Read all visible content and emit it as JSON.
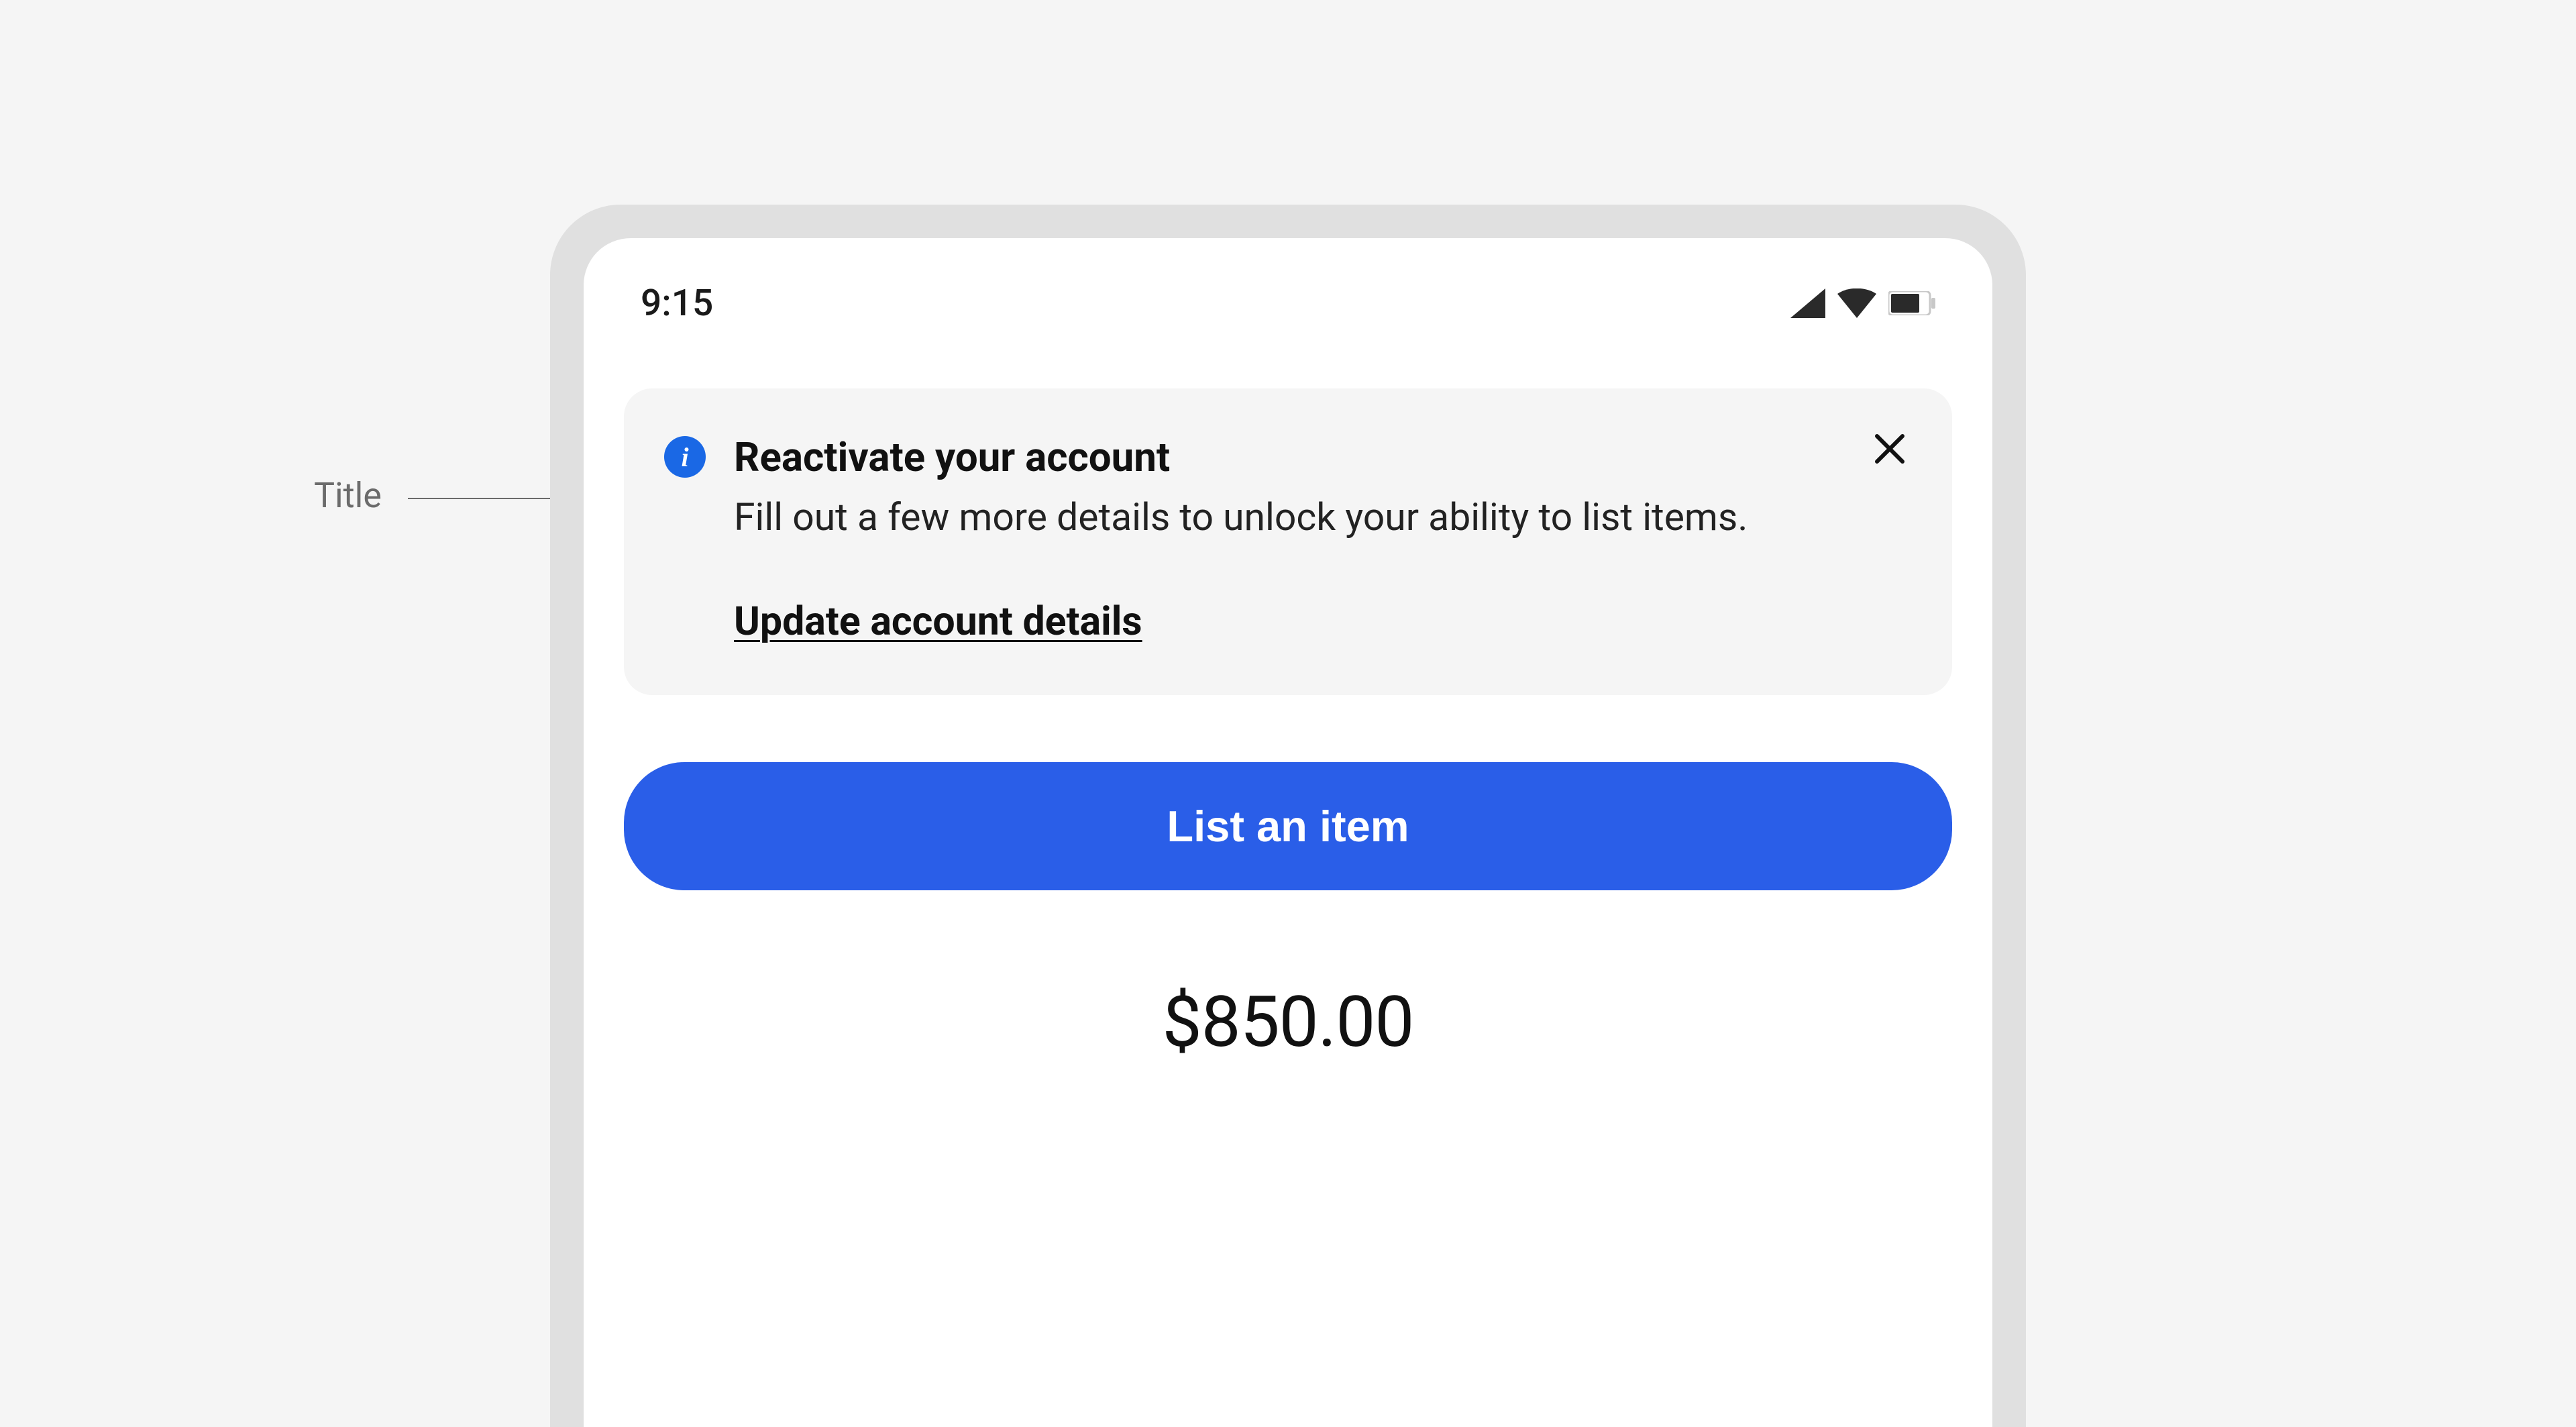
{
  "annotation": {
    "title_label": "Title"
  },
  "status": {
    "time": "9:15"
  },
  "alert": {
    "title": "Reactivate your account",
    "body": "Fill out a few more details to unlock your ability to list items.",
    "link": "Update account details"
  },
  "actions": {
    "primary": "List an item"
  },
  "amount": {
    "value": "$850.00"
  },
  "colors": {
    "primary_blue": "#2a5ee8",
    "info_blue": "#1a68e5",
    "card_bg": "#f5f5f5"
  }
}
